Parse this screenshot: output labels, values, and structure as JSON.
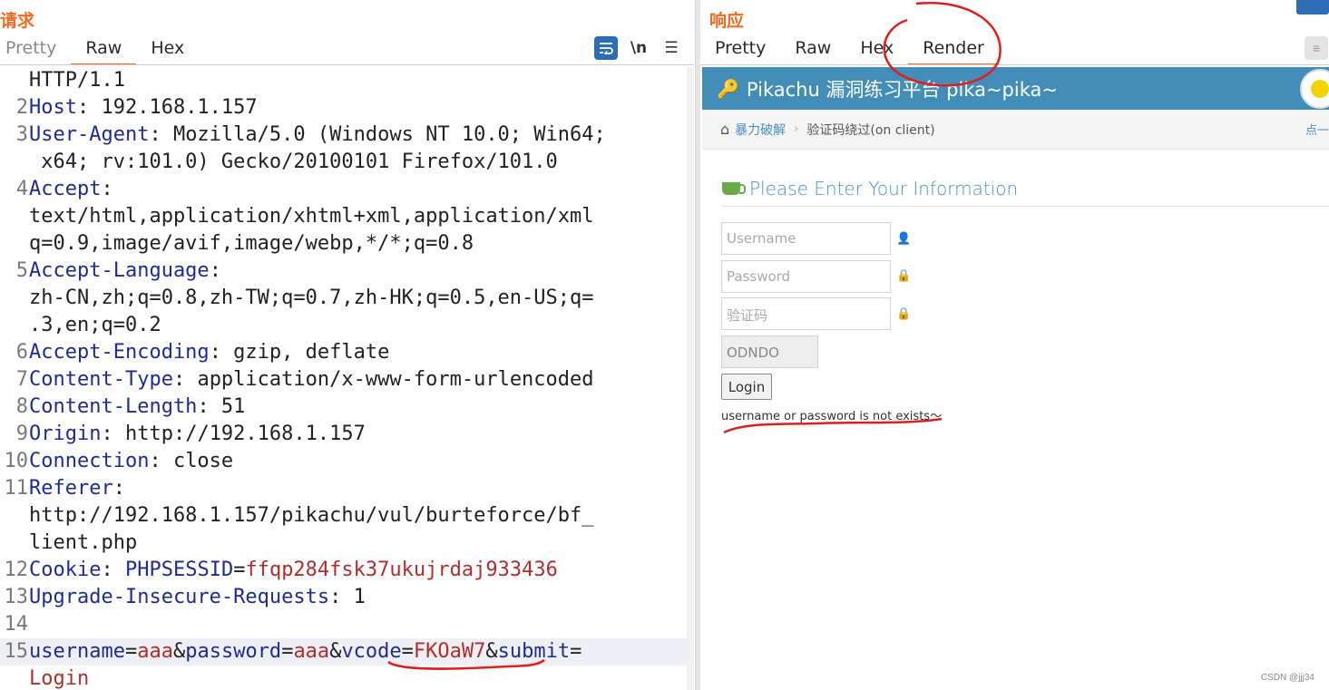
{
  "request": {
    "title": "请求",
    "tabs": [
      "Pretty",
      "Raw",
      "Hex"
    ],
    "active_tab": "Raw",
    "toolbar": {
      "wrap_icon": "wrap-lines-icon",
      "newline_label": "\\n",
      "menu_icon": "hamburger-menu-icon"
    },
    "lines": [
      {
        "n": "",
        "parts": [
          {
            "t": "HTTP/1.1",
            "c": ""
          }
        ]
      },
      {
        "n": "2",
        "parts": [
          {
            "t": "Host",
            "c": "k"
          },
          {
            "t": ": 192.168.1.157",
            "c": ""
          }
        ]
      },
      {
        "n": "3",
        "parts": [
          {
            "t": "User-Agent",
            "c": "k"
          },
          {
            "t": ": Mozilla/5.0 (Windows NT 10.0; Win64;",
            "c": ""
          }
        ]
      },
      {
        "n": "",
        "parts": [
          {
            "t": " x64; rv:101.0) Gecko/20100101 Firefox/101.0",
            "c": ""
          }
        ]
      },
      {
        "n": "4",
        "parts": [
          {
            "t": "Accept",
            "c": "k"
          },
          {
            "t": ":",
            "c": ""
          }
        ]
      },
      {
        "n": "",
        "parts": [
          {
            "t": "text/html,application/xhtml+xml,application/xml",
            "c": ""
          }
        ]
      },
      {
        "n": "",
        "parts": [
          {
            "t": "q=0.9,image/avif,image/webp,*/*;q=0.8",
            "c": ""
          }
        ]
      },
      {
        "n": "5",
        "parts": [
          {
            "t": "Accept-Language",
            "c": "k"
          },
          {
            "t": ":",
            "c": ""
          }
        ]
      },
      {
        "n": "",
        "parts": [
          {
            "t": "zh-CN,zh;q=0.8,zh-TW;q=0.7,zh-HK;q=0.5,en-US;q=",
            "c": ""
          }
        ]
      },
      {
        "n": "",
        "parts": [
          {
            "t": ".3,en;q=0.2",
            "c": ""
          }
        ]
      },
      {
        "n": "6",
        "parts": [
          {
            "t": "Accept-Encoding",
            "c": "k"
          },
          {
            "t": ": gzip, deflate",
            "c": ""
          }
        ]
      },
      {
        "n": "7",
        "parts": [
          {
            "t": "Content-Type",
            "c": "k"
          },
          {
            "t": ": application/x-www-form-urlencoded",
            "c": ""
          }
        ]
      },
      {
        "n": "8",
        "parts": [
          {
            "t": "Content-Length",
            "c": "k"
          },
          {
            "t": ": 51",
            "c": ""
          }
        ]
      },
      {
        "n": "9",
        "parts": [
          {
            "t": "Origin",
            "c": "k"
          },
          {
            "t": ": http://192.168.1.157",
            "c": ""
          }
        ]
      },
      {
        "n": "10",
        "parts": [
          {
            "t": "Connection",
            "c": "k"
          },
          {
            "t": ": close",
            "c": ""
          }
        ]
      },
      {
        "n": "11",
        "parts": [
          {
            "t": "Referer",
            "c": "k"
          },
          {
            "t": ":",
            "c": ""
          }
        ]
      },
      {
        "n": "",
        "parts": [
          {
            "t": "http://192.168.1.157/pikachu/vul/burteforce/bf_",
            "c": ""
          }
        ]
      },
      {
        "n": "",
        "parts": [
          {
            "t": "lient.php",
            "c": ""
          }
        ]
      },
      {
        "n": "12",
        "parts": [
          {
            "t": "Cookie",
            "c": "k"
          },
          {
            "t": ": ",
            "c": ""
          },
          {
            "t": "PHPSESSID",
            "c": "k"
          },
          {
            "t": "=",
            "c": ""
          },
          {
            "t": "ffqp284fsk37ukujrdaj933436",
            "c": "v"
          }
        ]
      },
      {
        "n": "13",
        "parts": [
          {
            "t": "Upgrade-Insecure-Requests",
            "c": "k"
          },
          {
            "t": ": 1",
            "c": ""
          }
        ]
      },
      {
        "n": "14",
        "parts": [
          {
            "t": "",
            "c": ""
          }
        ]
      },
      {
        "n": "15",
        "hl": true,
        "parts": [
          {
            "t": "username",
            "c": "k"
          },
          {
            "t": "=",
            "c": ""
          },
          {
            "t": "aaa",
            "c": "v"
          },
          {
            "t": "&",
            "c": ""
          },
          {
            "t": "password",
            "c": "k"
          },
          {
            "t": "=",
            "c": ""
          },
          {
            "t": "aaa",
            "c": "v"
          },
          {
            "t": "&",
            "c": ""
          },
          {
            "t": "vcode",
            "c": "k"
          },
          {
            "t": "=",
            "c": ""
          },
          {
            "t": "FKOaW7",
            "c": "v"
          },
          {
            "t": "&",
            "c": ""
          },
          {
            "t": "submit",
            "c": "k"
          },
          {
            "t": "=",
            "c": ""
          }
        ]
      },
      {
        "n": "",
        "parts": [
          {
            "t": "Login",
            "c": "v"
          }
        ]
      }
    ]
  },
  "response": {
    "title": "响应",
    "tabs": [
      "Pretty",
      "Raw",
      "Hex",
      "Render"
    ],
    "active_tab": "Render",
    "render": {
      "site_title": "Pikachu 漏洞练习平台 pika~pika~",
      "breadcrumb": {
        "link": "暴力破解",
        "current": "验证码绕过(on client)",
        "right_link": "点一"
      },
      "section_title": "Please Enter Your Information",
      "form": {
        "username_placeholder": "Username",
        "password_placeholder": "Password",
        "vcode_placeholder": "验证码",
        "vcode_value": "ODNDO",
        "login_label": "Login",
        "message": "username or password is not exists～"
      }
    }
  },
  "watermark": "CSDN @jjj34",
  "colors": {
    "accent": "#f26a21",
    "key": "#1f2a9e",
    "value": "#b32d2d",
    "navbar": "#438eb9",
    "annotation": "#e11d1d"
  }
}
